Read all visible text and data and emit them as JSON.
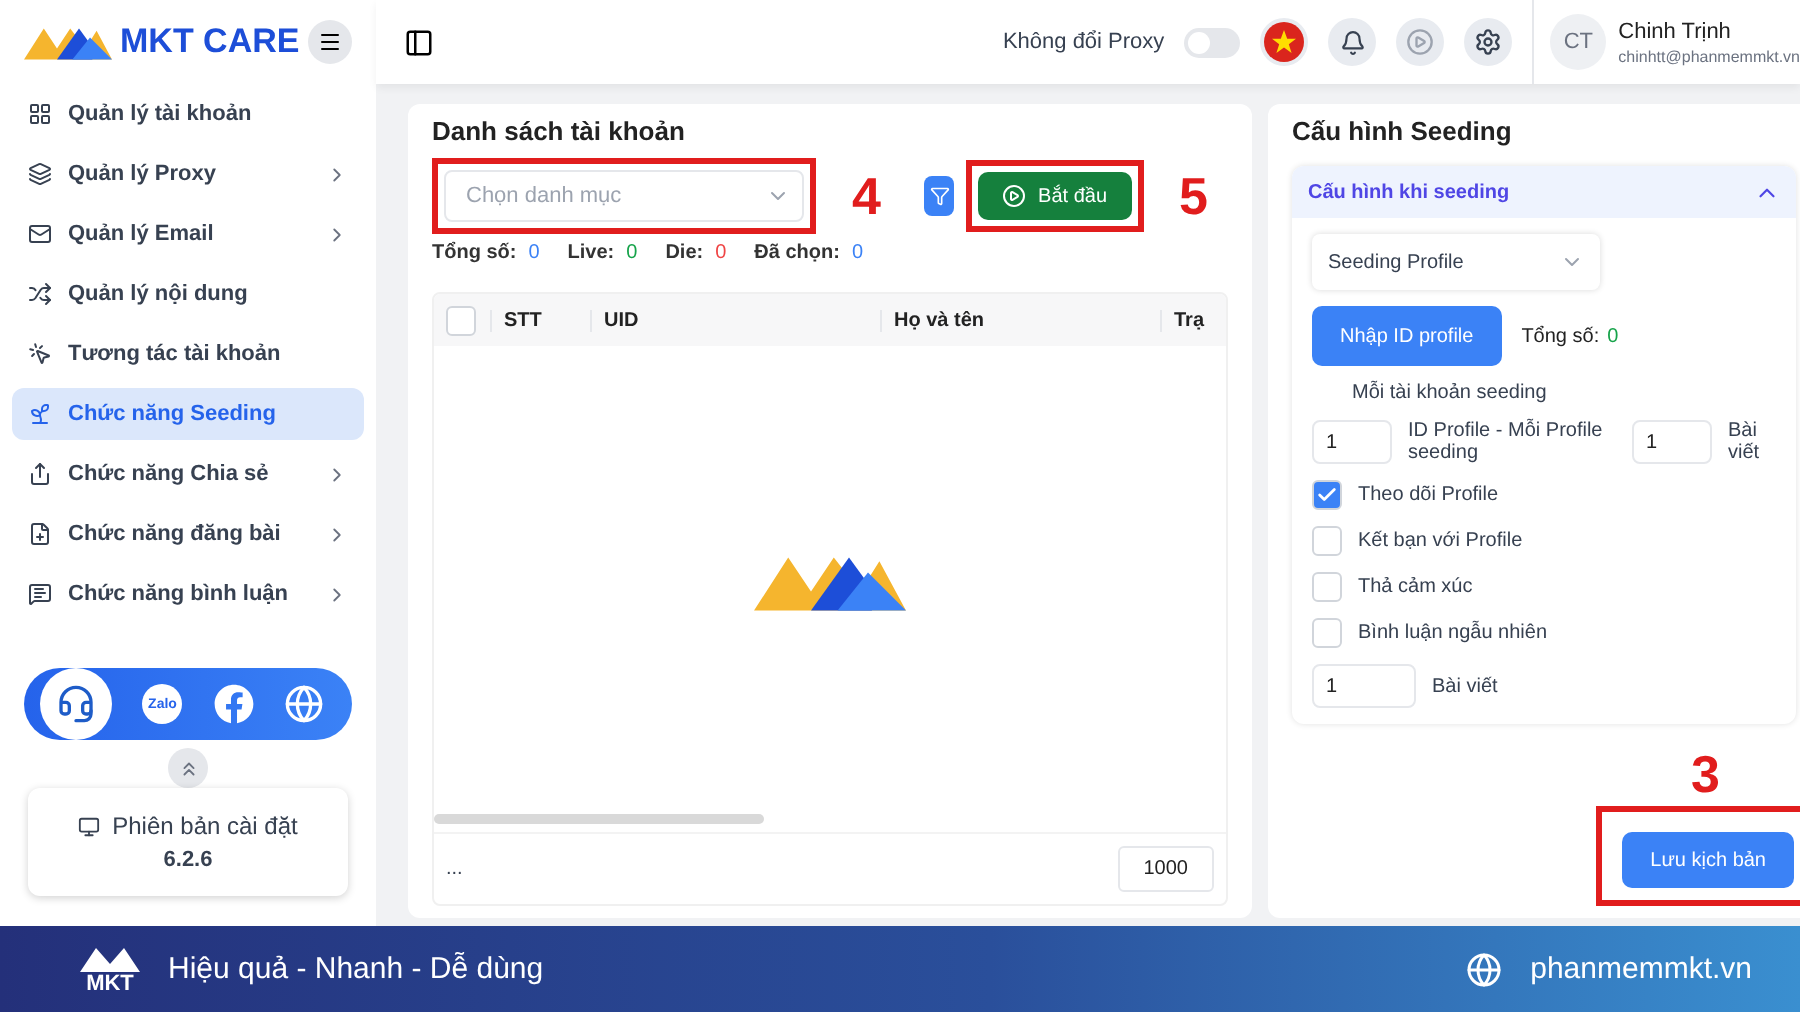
{
  "sidebar": {
    "brand": "MKT CARE",
    "items": [
      {
        "label": "Quản lý tài khoản",
        "expandable": false,
        "selected": false
      },
      {
        "label": "Quản lý Proxy",
        "expandable": true,
        "selected": false
      },
      {
        "label": "Quản lý Email",
        "expandable": true,
        "selected": false
      },
      {
        "label": "Quản lý nội dung",
        "expandable": false,
        "selected": false
      },
      {
        "label": "Tương tác tài khoản",
        "expandable": false,
        "selected": false
      },
      {
        "label": "Chức năng Seeding",
        "expandable": false,
        "selected": true
      },
      {
        "label": "Chức năng Chia sẻ",
        "expandable": true,
        "selected": false
      },
      {
        "label": "Chức năng đăng bài",
        "expandable": true,
        "selected": false
      },
      {
        "label": "Chức năng bình luận",
        "expandable": true,
        "selected": false
      }
    ],
    "social": [
      {
        "kind": "support"
      },
      {
        "kind": "zalo",
        "label": "Zalo"
      },
      {
        "kind": "facebook"
      },
      {
        "kind": "web"
      }
    ],
    "version": {
      "label": "Phiên bản cài đặt",
      "number": "6.2.6"
    }
  },
  "topbar": {
    "proxy_toggle": {
      "label": "Không đổi Proxy",
      "on": false
    },
    "user": {
      "initials": "CT",
      "name": "Chinh Trịnh",
      "email": "chinhtt@phanmemmkt.vn"
    }
  },
  "accounts": {
    "title": "Danh sách tài khoản",
    "category": {
      "placeholder": "Chọn danh mục",
      "callout": "4"
    },
    "start_button": {
      "label": "Bắt đầu",
      "callout": "5"
    },
    "stats": [
      {
        "label": "Tổng số:",
        "value": "0",
        "color": "#3b82f6"
      },
      {
        "label": "Live:",
        "value": "0",
        "color": "#16a34a"
      },
      {
        "label": "Die:",
        "value": "0",
        "color": "#ef4444"
      },
      {
        "label": "Đã chọn:",
        "value": "0",
        "color": "#3b82f6"
      }
    ],
    "all_selected": false,
    "columns": [
      "STT",
      "UID",
      "Họ và tên",
      "Trạ"
    ],
    "pagination": {
      "ellipsis": "...",
      "page_size": "1000"
    }
  },
  "seeding": {
    "title": "Cấu hình Seeding",
    "section": {
      "title": "Cấu hình khi seeding",
      "expanded": true
    },
    "profile_select": "Seeding Profile",
    "import_button": "Nhập ID profile",
    "total_label": "Tổng số:",
    "total_value": "0",
    "per_account_label": "Mỗi tài khoản seeding",
    "id_count": "1",
    "id_label": "ID Profile - Mỗi Profile seeding",
    "post_count": "1",
    "post_label": "Bài viết",
    "options": [
      {
        "label": "Theo dõi Profile",
        "checked": true
      },
      {
        "label": "Kết bạn với Profile",
        "checked": false
      },
      {
        "label": "Thả cảm xúc",
        "checked": false
      },
      {
        "label": "Bình luận ngẫu nhiên",
        "checked": false
      }
    ],
    "post_limit": "1",
    "post_limit_label": "Bài viết",
    "save_button": {
      "label": "Lưu kịch bản",
      "callout": "3"
    }
  },
  "footer": {
    "logo": "MKT",
    "tagline": "Hiệu quả - Nhanh - Dễ dùng",
    "website": "phanmemmkt.vn"
  }
}
